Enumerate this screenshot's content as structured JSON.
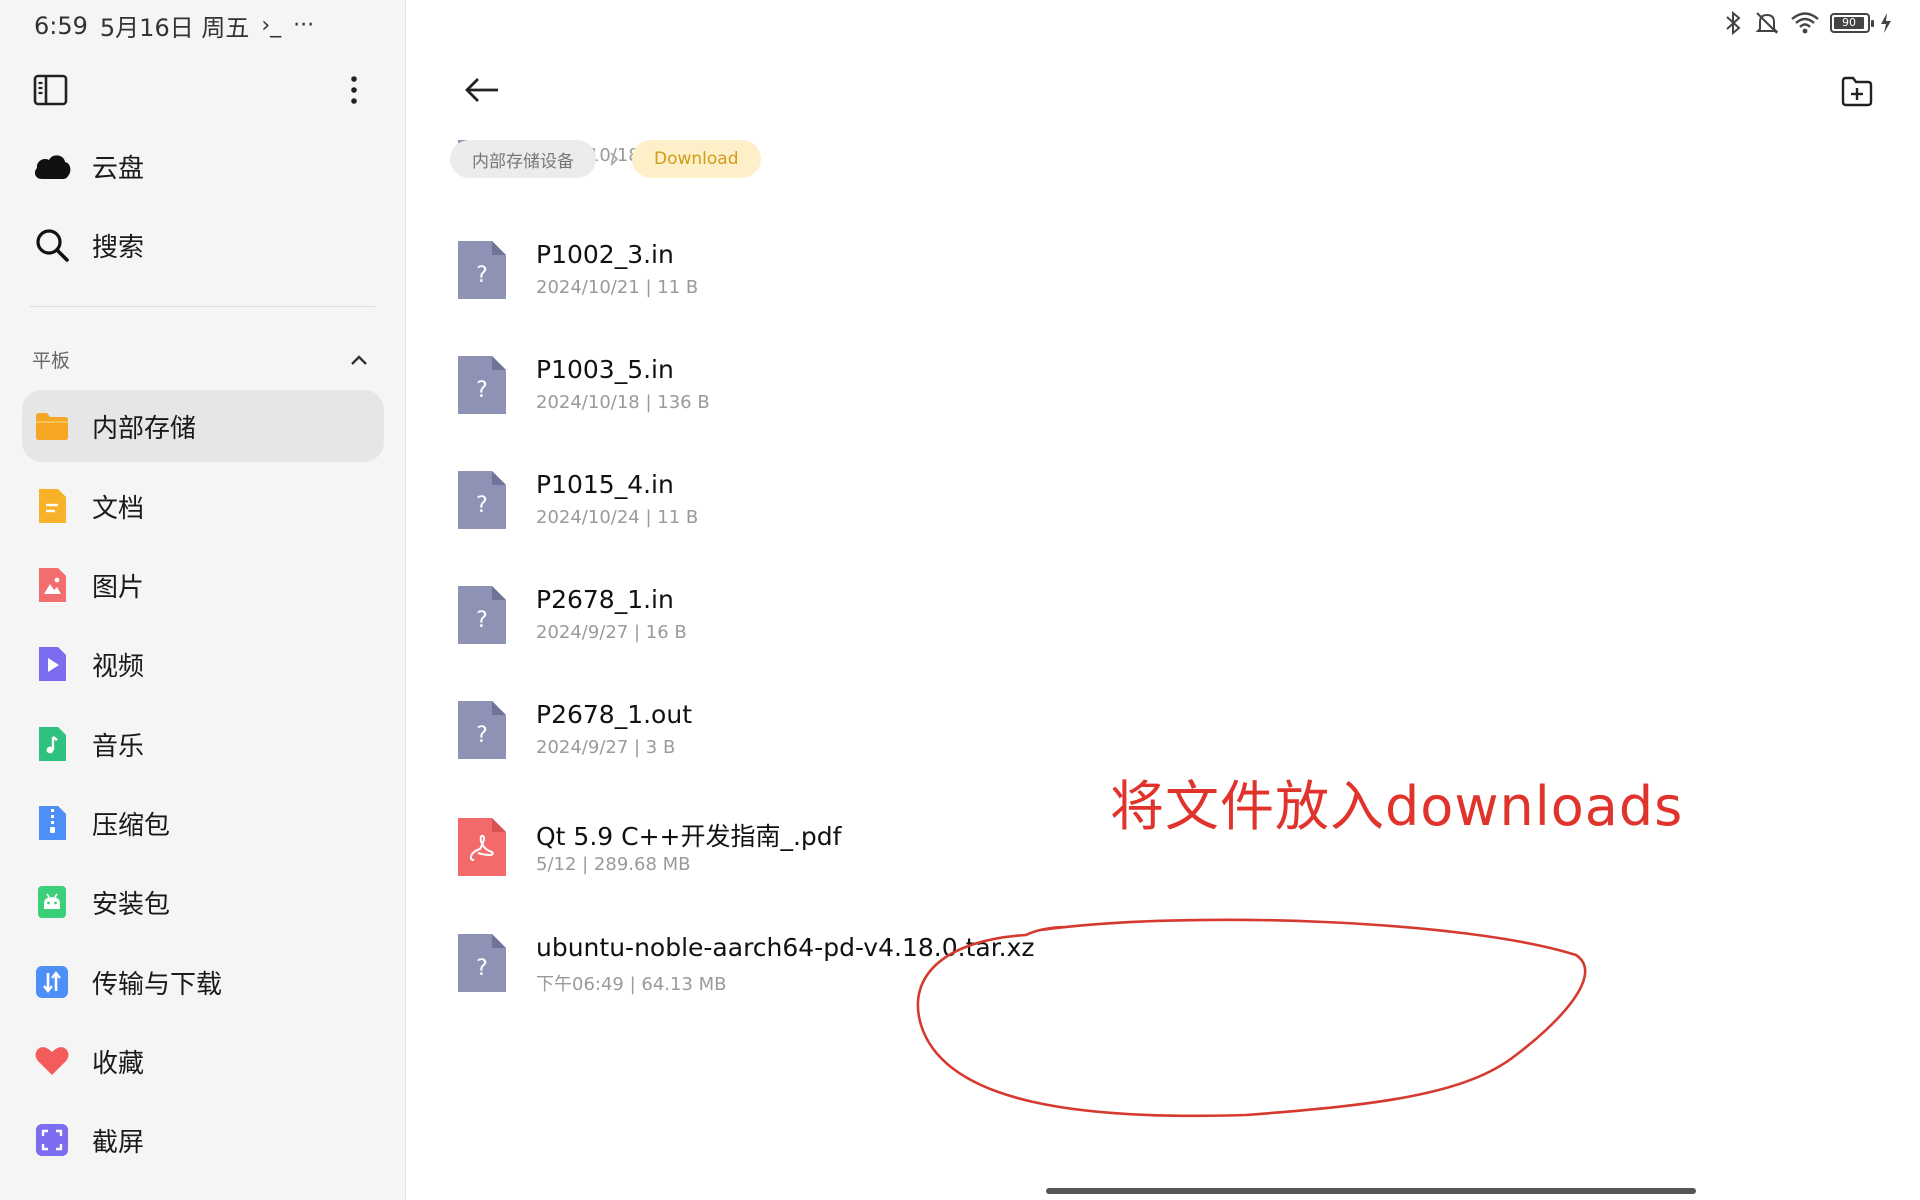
{
  "status_bar": {
    "time": "6:59",
    "date": "5月16日 周五",
    "terminal_glyph": "›_",
    "more_glyph": "···",
    "battery": "90"
  },
  "sidebar": {
    "primary_items": [
      {
        "label": "云盘",
        "icon": "cloud-icon"
      },
      {
        "label": "搜索",
        "icon": "search-icon"
      }
    ],
    "section_label": "平板",
    "items": [
      {
        "label": "内部存储",
        "icon": "folder-icon",
        "color": "#f5a623",
        "active": true
      },
      {
        "label": "文档",
        "icon": "document-icon",
        "color": "#f8b22a"
      },
      {
        "label": "图片",
        "icon": "image-icon",
        "color": "#f26d6d"
      },
      {
        "label": "视频",
        "icon": "video-icon",
        "color": "#7b6cf0"
      },
      {
        "label": "音乐",
        "icon": "music-icon",
        "color": "#2ec27e"
      },
      {
        "label": "压缩包",
        "icon": "archive-icon",
        "color": "#4d8ef7"
      },
      {
        "label": "安装包",
        "icon": "android-icon",
        "color": "#3ccf79"
      },
      {
        "label": "传输与下载",
        "icon": "transfer-icon",
        "color": "#4d8ef7"
      },
      {
        "label": "收藏",
        "icon": "heart-icon",
        "color": "#f45b5b"
      },
      {
        "label": "截屏",
        "icon": "screenshot-icon",
        "color": "#7b6cf0"
      }
    ]
  },
  "breadcrumb": {
    "storage": "内部存储设备",
    "current": "Download"
  },
  "files": [
    {
      "name": "",
      "meta": "2024/10/18  |  9 B",
      "type": "unknown"
    },
    {
      "name": "P1002_3.in",
      "meta": "2024/10/21  |  11 B",
      "type": "unknown"
    },
    {
      "name": "P1003_5.in",
      "meta": "2024/10/18  |  136 B",
      "type": "unknown"
    },
    {
      "name": "P1015_4.in",
      "meta": "2024/10/24  |  11 B",
      "type": "unknown"
    },
    {
      "name": "P2678_1.in",
      "meta": "2024/9/27  |  16 B",
      "type": "unknown"
    },
    {
      "name": "P2678_1.out",
      "meta": "2024/9/27  |  3 B",
      "type": "unknown"
    },
    {
      "name": "Qt 5.9 C++开发指南_.pdf",
      "meta": "5/12  |  289.68 MB",
      "type": "pdf"
    },
    {
      "name": "ubuntu-noble-aarch64-pd-v4.18.0.tar.xz",
      "meta": "下午06:49  |  64.13 MB",
      "type": "unknown"
    }
  ],
  "annotation": {
    "text": "将文件放入downloads",
    "color": "#e0332b"
  },
  "colors": {
    "unknown_file": "#8e92b4",
    "pdf_file": "#f26a6a",
    "breadcrumb_active_text": "#d49b1c",
    "breadcrumb_active_bg": "#fdf0c8"
  }
}
